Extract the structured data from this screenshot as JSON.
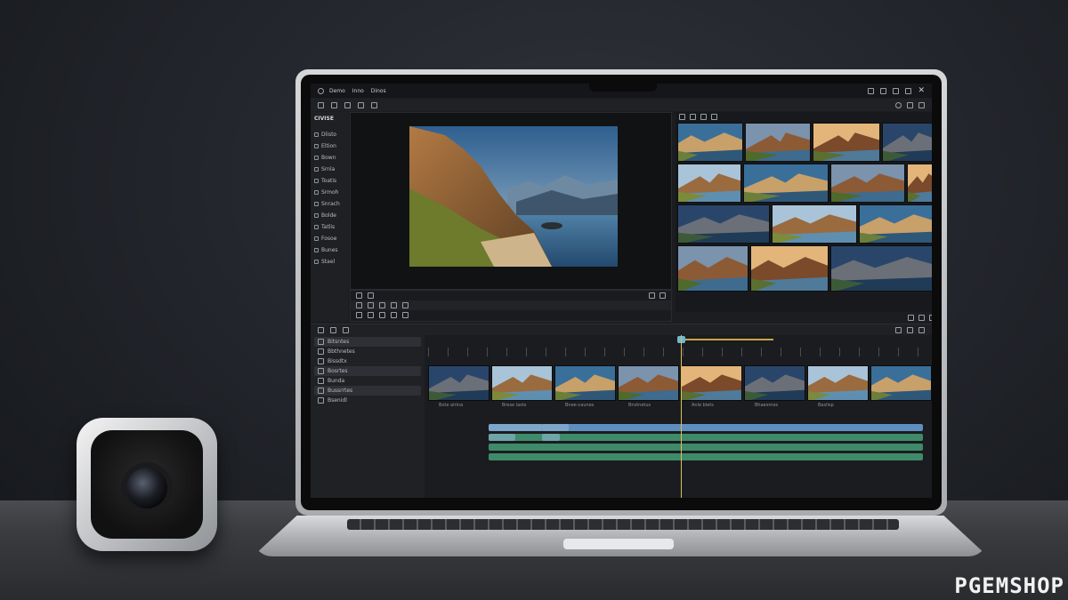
{
  "watermark": "PGEMSHOP",
  "editor": {
    "titlebar": {
      "menu": [
        "Demo",
        "Inno",
        "Dinos"
      ]
    },
    "window_controls": [
      "minimize",
      "restore",
      "maximize",
      "close"
    ],
    "sidebar": {
      "header": "CIVISE",
      "items": [
        "Dlisto",
        "Eltion",
        "Bown",
        "Srnla",
        "Toatis",
        "Srmoh",
        "Snrach",
        "Bolde",
        "Tatlis",
        "Fosoe",
        "Bunes",
        "Stael"
      ]
    },
    "timeline_tracks": [
      "Bitsntes",
      "Bbthnetes",
      "Bissdtx",
      "Bosrtes",
      "Bunda",
      "Bussrrtes",
      "Bsenidl"
    ],
    "clip_labels": [
      "Bxte alrina",
      "Brese lasts",
      "Bnee-caunes",
      "Bnstnetus",
      "Anle blets",
      "Bhaesrnes",
      "Basllsp"
    ],
    "colors": {
      "accent": "#6fb7d8",
      "playhead": "#d9c25a",
      "video_lane": "#5f8fbf",
      "audio_lane": "#3f8a6a"
    }
  }
}
